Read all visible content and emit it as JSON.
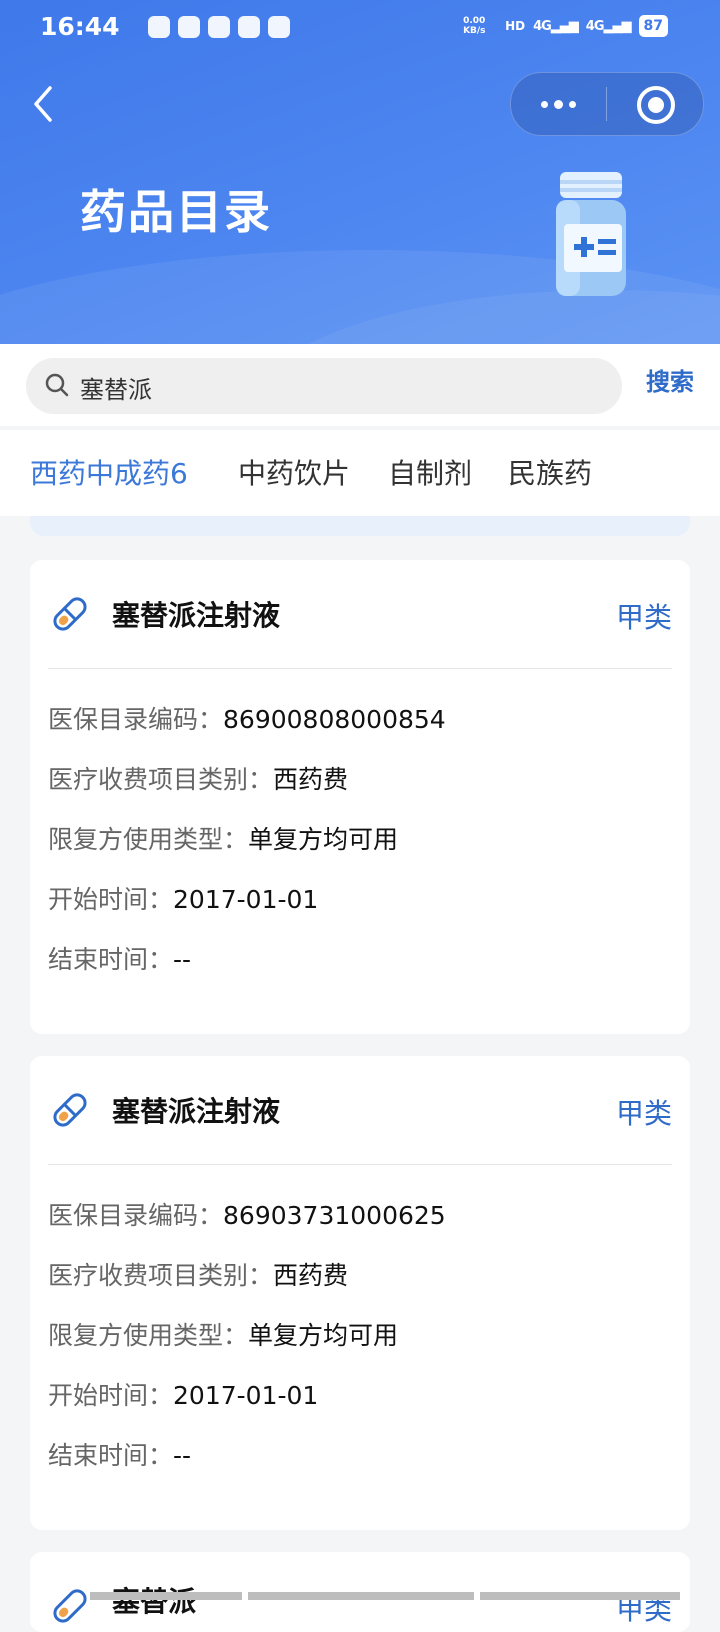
{
  "status_bar": {
    "time": "16:44",
    "net_speed": "0.00 KB/s",
    "hd": "HD",
    "sim1": "4G",
    "sim2": "4G",
    "battery": "87"
  },
  "header": {
    "title": "药品目录",
    "back_icon": "chevron-left-icon",
    "more_icon": "more-dots-icon",
    "close_icon": "target-close-icon",
    "gradient_start": "#3f79ea",
    "gradient_end": "#5b93f4"
  },
  "search": {
    "value": "塞替派",
    "button_label": "搜索"
  },
  "tabs": [
    {
      "label": "西药中成药",
      "count": "6",
      "active": true
    },
    {
      "label": "中药饮片",
      "active": false
    },
    {
      "label": "自制剂",
      "active": false
    },
    {
      "label": "民族药",
      "active": false
    }
  ],
  "accent_color": "#2f6cc9",
  "drugs": [
    {
      "name": "塞替派注射液",
      "class": "甲类",
      "fields": [
        {
          "label": "医保目录编码：",
          "value": "86900808000854"
        },
        {
          "label": "医疗收费项目类别：",
          "value": "西药费"
        },
        {
          "label": "限复方使用类型：",
          "value": "单复方均可用"
        },
        {
          "label": "开始时间：",
          "value": "2017-01-01"
        },
        {
          "label": "结束时间：",
          "value": "--"
        }
      ]
    },
    {
      "name": "塞替派注射液",
      "class": "甲类",
      "fields": [
        {
          "label": "医保目录编码：",
          "value": "86903731000625"
        },
        {
          "label": "医疗收费项目类别：",
          "value": "西药费"
        },
        {
          "label": "限复方使用类型：",
          "value": "单复方均可用"
        },
        {
          "label": "开始时间：",
          "value": "2017-01-01"
        },
        {
          "label": "结束时间：",
          "value": "--"
        }
      ]
    },
    {
      "name": "塞替派",
      "class": "甲类"
    }
  ]
}
